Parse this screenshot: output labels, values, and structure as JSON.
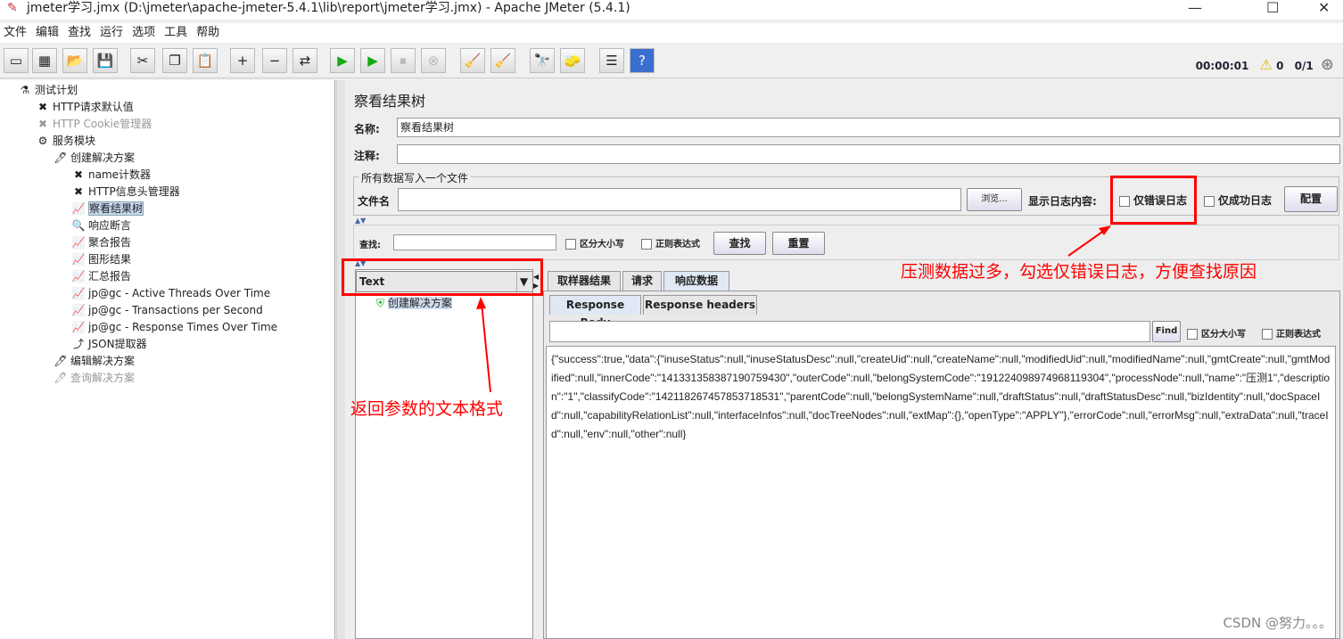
{
  "window": {
    "title": "jmeter学习.jmx (D:\\jmeter\\apache-jmeter-5.4.1\\lib\\report\\jmeter学习.jmx) - Apache JMeter (5.4.1)",
    "minimize": "—",
    "maximize": "☐",
    "close": "✕"
  },
  "menu": [
    "文件",
    "编辑",
    "查找",
    "运行",
    "选项",
    "工具",
    "帮助"
  ],
  "toolbar": {
    "icons": [
      "new-icon",
      "templates-icon",
      "open-icon",
      "save-icon",
      "cut-icon",
      "copy-icon",
      "paste-icon",
      "expand-icon",
      "collapse-icon",
      "toggle-icon",
      "start-icon",
      "start-no-pause-icon",
      "stop-icon",
      "shutdown-icon",
      "clear-icon",
      "clear-all-icon",
      "search-icon",
      "reset-search-icon",
      "function-helper-icon",
      "help-icon"
    ],
    "glyphs": [
      "▭",
      "▦",
      "📂",
      "💾",
      "✂",
      "❐",
      "📋",
      "+",
      "−",
      "⇄",
      "▶",
      "▶",
      "⏹",
      "⊗",
      "🧹",
      "🧹",
      "🔭",
      "🧽",
      "☰",
      "?"
    ]
  },
  "status": {
    "timer": "00:00:01",
    "warnings": "0",
    "threads": "0/1"
  },
  "tree": [
    {
      "label": "测试计划",
      "icon": "test-plan-icon",
      "glyph": "⚗",
      "level": 0
    },
    {
      "label": "HTTP请求默认值",
      "icon": "tools-icon",
      "glyph": "✖",
      "level": 1
    },
    {
      "label": "HTTP Cookie管理器",
      "icon": "tools-icon",
      "glyph": "✖",
      "level": 1,
      "disabled": true
    },
    {
      "label": "服务模块",
      "icon": "gear-icon",
      "glyph": "⚙",
      "level": 1
    },
    {
      "label": "创建解决方案",
      "icon": "sampler-icon",
      "glyph": "🖊",
      "level": 2
    },
    {
      "label": "name计数器",
      "icon": "tools-icon",
      "glyph": "✖",
      "level": 3
    },
    {
      "label": "HTTP信息头管理器",
      "icon": "tools-icon",
      "glyph": "✖",
      "level": 3
    },
    {
      "label": "察看结果树",
      "icon": "listener-icon",
      "glyph": "📈",
      "level": 3,
      "selected": true
    },
    {
      "label": "响应断言",
      "icon": "magnifier-icon",
      "glyph": "🔍",
      "level": 3
    },
    {
      "label": "聚合报告",
      "icon": "listener-icon",
      "glyph": "📈",
      "level": 3
    },
    {
      "label": "图形结果",
      "icon": "listener-icon",
      "glyph": "📈",
      "level": 3
    },
    {
      "label": "汇总报告",
      "icon": "listener-icon",
      "glyph": "📈",
      "level": 3
    },
    {
      "label": "jp@gc - Active Threads Over Time",
      "icon": "listener-icon",
      "glyph": "📈",
      "level": 3
    },
    {
      "label": "jp@gc - Transactions per Second",
      "icon": "listener-icon",
      "glyph": "📈",
      "level": 3
    },
    {
      "label": "jp@gc - Response Times Over Time",
      "icon": "listener-icon",
      "glyph": "📈",
      "level": 3
    },
    {
      "label": "JSON提取器",
      "icon": "extractor-icon",
      "glyph": "⤴",
      "level": 3
    },
    {
      "label": "编辑解决方案",
      "icon": "sampler-icon",
      "glyph": "🖊",
      "level": 2
    },
    {
      "label": "查询解决方案",
      "icon": "sampler-icon",
      "glyph": "🖊",
      "level": 2,
      "disabled": true
    }
  ],
  "panel": {
    "title": "察看结果树",
    "name_label": "名称:",
    "name_value": "察看结果树",
    "comment_label": "注释:",
    "comment_value": "",
    "file_group": "所有数据写入一个文件",
    "file_label": "文件名",
    "file_value": "",
    "browse": "浏览...",
    "log_label": "显示日志内容:",
    "errors_only": "仅错误日志",
    "success_only": "仅成功日志",
    "configure": "配置",
    "search_label": "查找:",
    "search_value": "",
    "case_sensitive": "区分大小写",
    "regex": "正则表达式",
    "search_btn": "查找",
    "reset_btn": "重置",
    "renderer": "Text",
    "result_item": "创建解决方案",
    "tabs": [
      "取样器结果",
      "请求",
      "响应数据"
    ],
    "subtabs": [
      "Response Body",
      "Response headers"
    ],
    "find_btn": "Find",
    "find_case": "区分大小写",
    "find_regex": "正则表达式",
    "response_body": "{\"success\":true,\"data\":{\"inuseStatus\":null,\"inuseStatusDesc\":null,\"createUid\":null,\"createName\":null,\"modifiedUid\":null,\"modifiedName\":null,\"gmtCreate\":null,\"gmtModified\":null,\"innerCode\":\"141331358387190759430\",\"outerCode\":null,\"belongSystemCode\":\"191224098974968119304\",\"processNode\":null,\"name\":\"压测1\",\"description\":\"1\",\"classifyCode\":\"142118267457853718531\",\"parentCode\":null,\"belongSystemName\":null,\"draftStatus\":null,\"draftStatusDesc\":null,\"bizIdentity\":null,\"docSpaceId\":null,\"capabilityRelationList\":null,\"interfaceInfos\":null,\"docTreeNodes\":null,\"extMap\":{},\"openType\":\"APPLY\"},\"errorCode\":null,\"errorMsg\":null,\"extraData\":null,\"traceId\":null,\"env\":null,\"other\":null}"
  },
  "annotations": {
    "note1": "压测数据过多，勾选仅错误日志，方便查找原因",
    "note2": "返回参数的文本格式",
    "color": "#ff0000"
  },
  "watermark": "CSDN @努力。。。"
}
